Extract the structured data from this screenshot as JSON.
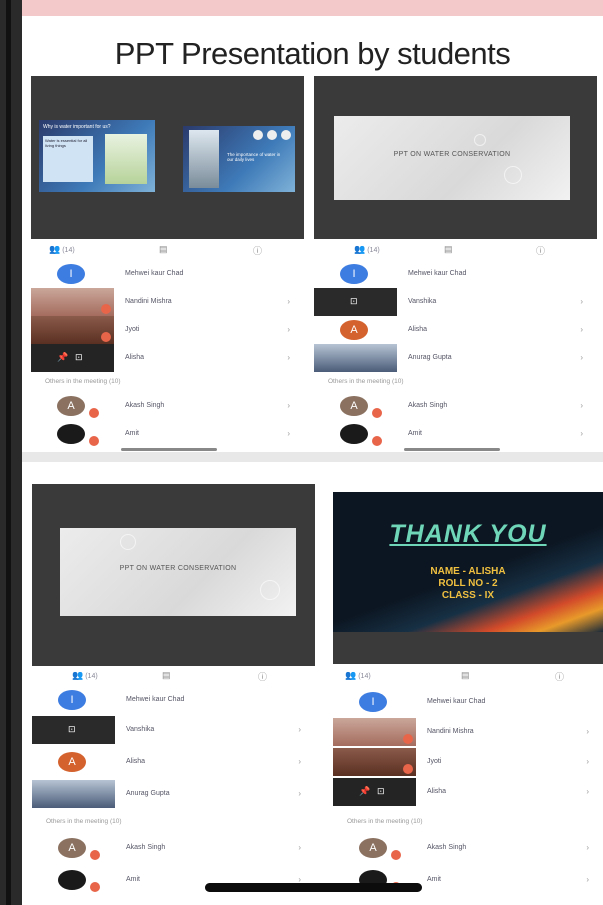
{
  "page": {
    "title": "PPT Presentation by students"
  },
  "tabs": {
    "people_count": "(14)",
    "chat_icon": "chat-icon",
    "info_icon": "info-icon"
  },
  "others_label": "Others in the meeting (10)",
  "slides": {
    "water": "PPT ON WATER CONSERVATION",
    "thank_you": "THANK YOU",
    "name_line": "NAME - ALISHA",
    "roll_line": "ROLL NO - 2",
    "class_line": "CLASS - IX",
    "info_title": "Why is water important for us?",
    "info_body": "Water is essential for all living things",
    "info_side": "The importance of water in our daily lives"
  },
  "participants": {
    "host": "Mehwei kaur Chad",
    "navdeep": "Nandini Mishra",
    "jyoti": "Jyoti",
    "alisha": "Alisha",
    "vanshika": "Vanshika",
    "anurag": "Anurag Gupta",
    "akash": "Akash Singh",
    "amit": "Amit"
  },
  "colors": {
    "accent_blue": "#3d7ce0",
    "avatar_orange": "#d4622e",
    "avatar_brown": "#8a7160",
    "badge_red": "#e8654a"
  }
}
